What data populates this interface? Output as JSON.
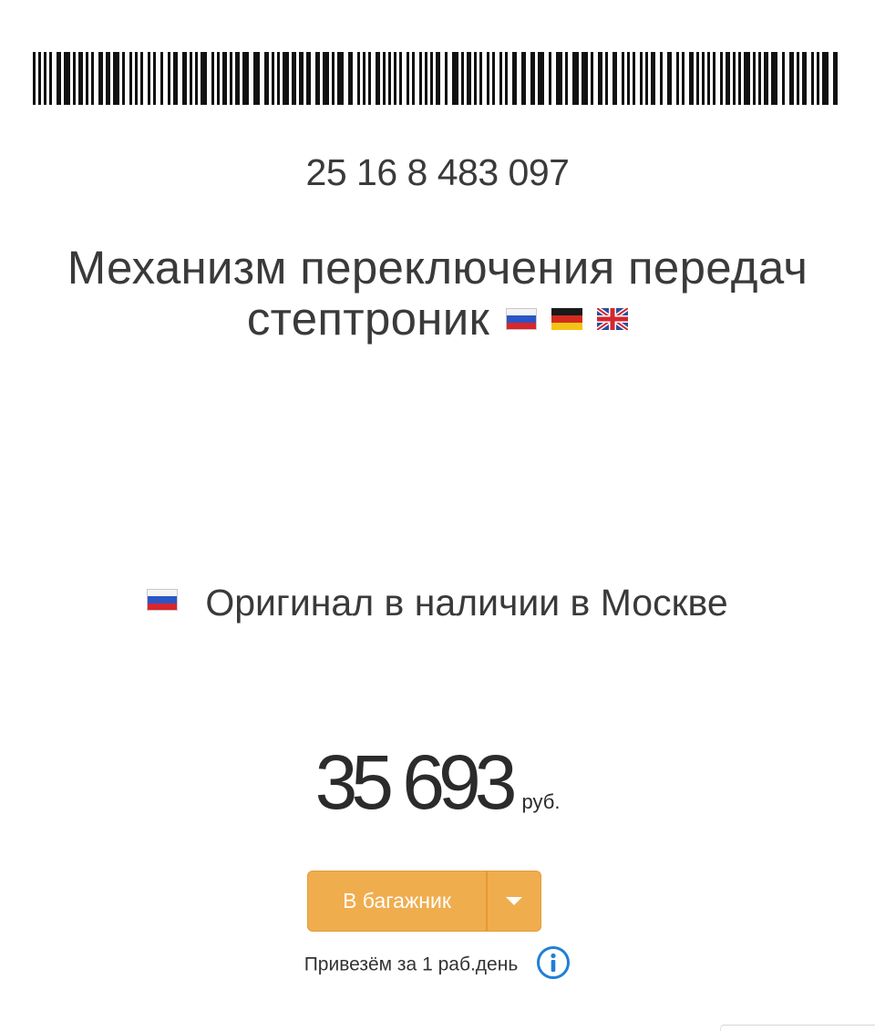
{
  "product": {
    "part_number": "25 16 8 483 097",
    "title": "Механизм переключения передач стептроник",
    "title_flags": [
      "flag-ru-icon",
      "flag-de-icon",
      "flag-gb-icon"
    ]
  },
  "availability": {
    "flag": "flag-ru-icon",
    "text": "Оригинал в наличии в Москве"
  },
  "price": {
    "value": "35 693",
    "currency": "руб."
  },
  "cart": {
    "button_label": "В багажник",
    "toggle_icon": "caret-down-icon",
    "color": "#f0ad4e"
  },
  "delivery": {
    "text": "Привезём за 1 раб.день",
    "info_icon": "info-icon",
    "info_color": "#1f7fd6"
  }
}
